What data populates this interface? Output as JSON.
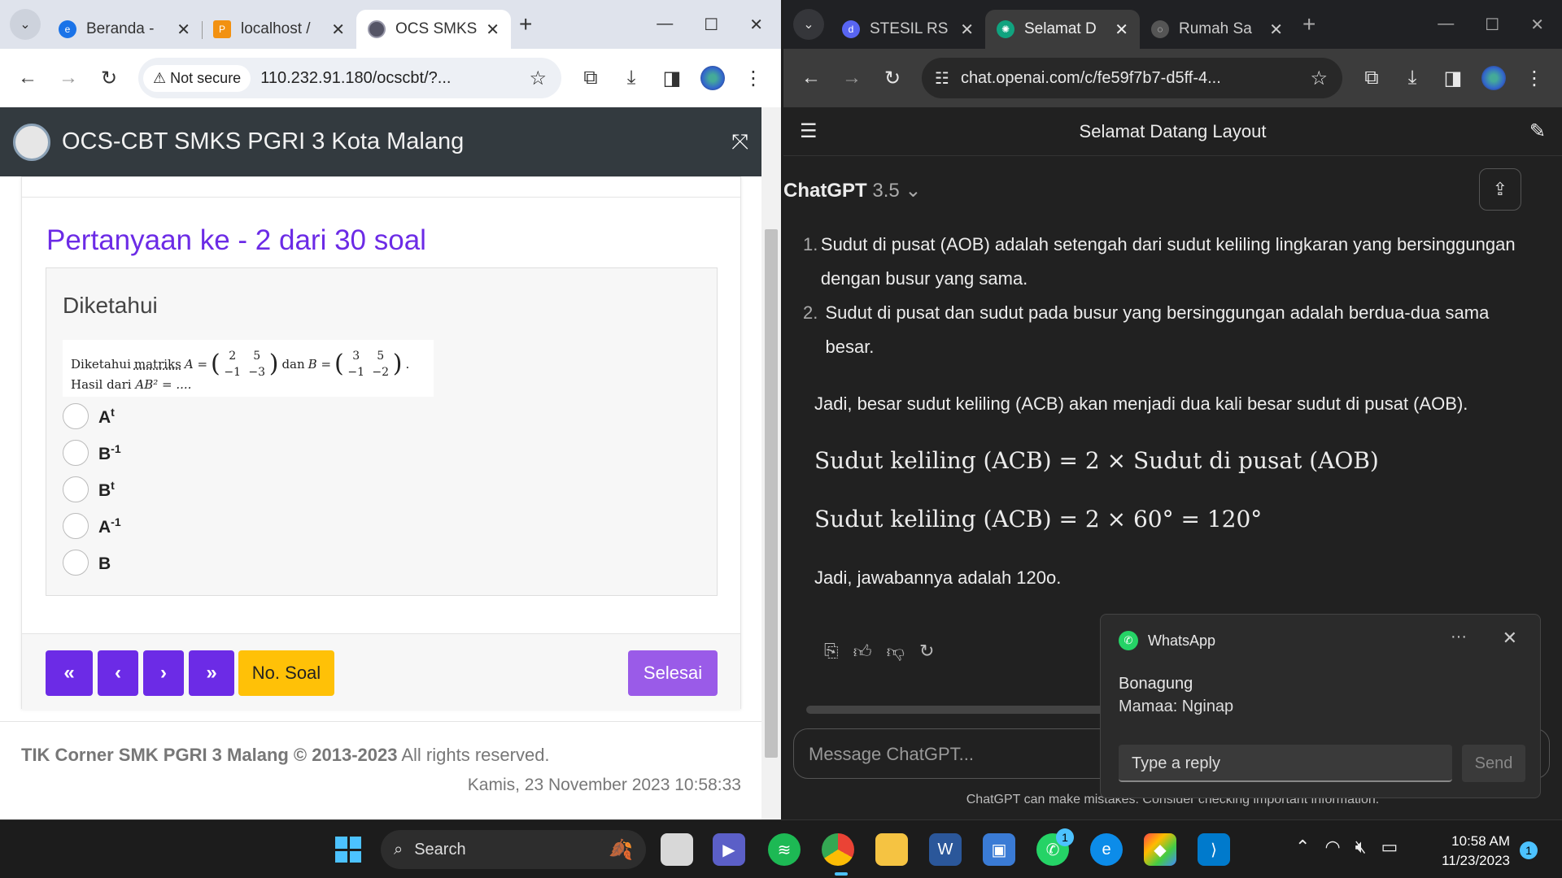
{
  "left_window": {
    "tabs": [
      {
        "title": "Beranda -",
        "icon": "edge-icon",
        "active": false
      },
      {
        "title": "localhost /",
        "icon": "phpmyadmin-icon",
        "active": false
      },
      {
        "title": "OCS SMKS",
        "icon": "school-logo-icon",
        "active": true
      }
    ],
    "address": {
      "security_label": "Not secure",
      "url": "110.232.91.180/ocscbt/?..."
    },
    "app_title": "OCS-CBT SMKS PGRI 3 Kota Malang",
    "question_title": "Pertanyaan ke - 2 dari 30 soal",
    "section_heading": "Diketahui",
    "question_text": {
      "prefix": "Diketahui",
      "word_matriks": "matriks",
      "a_label": "A =",
      "matrix_a": [
        "2",
        "5",
        "−1",
        "−3"
      ],
      "dan": "dan",
      "b_label": "B =",
      "matrix_b": [
        "3",
        "5",
        "−1",
        "−2"
      ],
      "line2_prefix": "Hasil dari",
      "line2_expr": "AB² = ....",
      "period": "."
    },
    "options": [
      {
        "base": "A",
        "sup": "t"
      },
      {
        "base": "B",
        "sup": "-1"
      },
      {
        "base": "B",
        "sup": "t"
      },
      {
        "base": "A",
        "sup": "-1"
      },
      {
        "base": "B",
        "sup": ""
      }
    ],
    "nav": {
      "first": "«",
      "prev": "‹",
      "next": "›",
      "last": "»",
      "no_soal": "No. Soal",
      "finish": "Selesai"
    },
    "footer": {
      "brand": "TIK Corner SMK PGRI 3 Malang © 2013-2023",
      "rights": " All rights reserved.",
      "datetime": "Kamis, 23 November 2023 10:58:33"
    }
  },
  "right_window": {
    "tabs": [
      {
        "title": "STESIL RS",
        "icon": "discord-icon",
        "active": false
      },
      {
        "title": "Selamat D",
        "icon": "chatgpt-icon",
        "active": true
      },
      {
        "title": "Rumah Sa",
        "icon": "globe-icon",
        "active": false
      }
    ],
    "address": {
      "url": "chat.openai.com/c/fe59f7b7-d5ff-4..."
    },
    "chat_title": "Selamat Datang Layout",
    "model": {
      "name": "ChatGPT",
      "version": "3.5"
    },
    "list_items": [
      {
        "num": "1.",
        "text": "Sudut di pusat (AOB) adalah setengah dari sudut keliling lingkaran yang bersinggungan dengan busur yang sama."
      },
      {
        "num": "2.",
        "text": "Sudut di pusat dan sudut pada busur yang bersinggungan adalah berdua-dua sama besar."
      }
    ],
    "paragraph1": "Jadi, besar sudut keliling (ACB) akan menjadi dua kali besar sudut di pusat (AOB).",
    "formula1": "Sudut keliling (ACB) = 2 × Sudut di pusat (AOB)",
    "formula2": "Sudut keliling (ACB) = 2 × 60° = 120°",
    "paragraph2": "Jadi, jawabannya adalah 120o.",
    "composer_placeholder": "Message ChatGPT...",
    "disclaimer": "ChatGPT can make mistakes. Consider checking important information."
  },
  "notification": {
    "app": "WhatsApp",
    "sender": "Bonagung",
    "message": "Mamaa: Nginap",
    "reply_placeholder": "Type a reply",
    "send_label": "Send"
  },
  "taskbar": {
    "search_label": "Search",
    "whatsapp_badge": "1",
    "time": "10:58 AM",
    "date": "11/23/2023",
    "notification_count": "1"
  }
}
